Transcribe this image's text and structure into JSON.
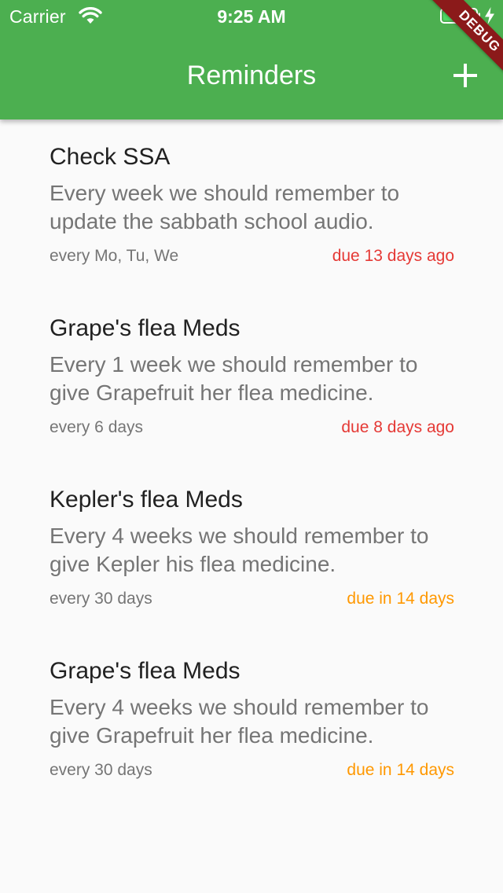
{
  "status_bar": {
    "carrier": "Carrier",
    "time": "9:25 AM"
  },
  "app_bar": {
    "title": "Reminders",
    "add_icon": "plus-icon",
    "background_color": "#4caf50"
  },
  "debug_banner": "DEBUG",
  "colors": {
    "overdue": "#e53935",
    "upcoming": "#ff9800"
  },
  "reminders": [
    {
      "title": "Check SSA",
      "description": "Every week we should remember to update the sabbath school audio.",
      "schedule": "every Mo, Tu, We",
      "due": "due 13 days ago",
      "status": "overdue"
    },
    {
      "title": "Grape's flea Meds",
      "description": "Every 1 week we should remember to give Grapefruit her flea medicine.",
      "schedule": "every 6 days",
      "due": "due 8 days ago",
      "status": "overdue"
    },
    {
      "title": "Kepler's flea Meds",
      "description": "Every 4 weeks we should remember to give Kepler his flea medicine.",
      "schedule": "every 30 days",
      "due": "due in 14 days",
      "status": "upcoming"
    },
    {
      "title": "Grape's flea Meds",
      "description": "Every 4 weeks we should remember to give Grapefruit her flea medicine.",
      "schedule": "every 30 days",
      "due": "due in 14 days",
      "status": "upcoming"
    }
  ]
}
